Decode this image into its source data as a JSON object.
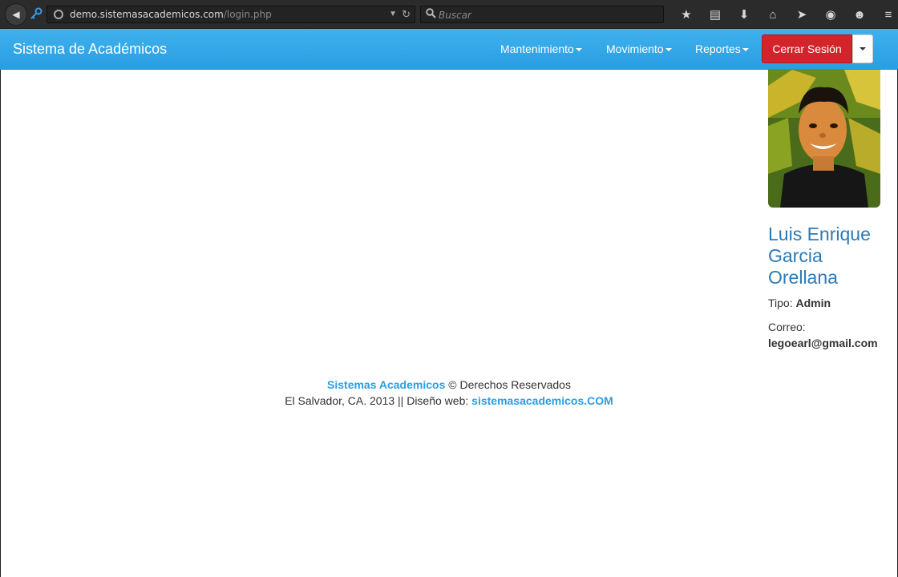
{
  "browser": {
    "url_domain": "demo.sistemasacademicos.com",
    "url_path": "/login.php",
    "search_placeholder": "Buscar",
    "toolbar_icons": [
      "star-icon",
      "reading-list-icon",
      "download-icon",
      "home-icon",
      "send-icon",
      "pocket-icon",
      "chat-icon",
      "menu-icon"
    ]
  },
  "navbar": {
    "brand": "Sistema de Académicos",
    "menu": [
      {
        "label": "Mantenimiento"
      },
      {
        "label": "Movimiento"
      },
      {
        "label": "Reportes"
      }
    ],
    "logout_label": "Cerrar Sesión",
    "color": "#2a9ee0",
    "logout_color": "#d2242b"
  },
  "profile": {
    "name_line1": "Luis Enrique",
    "name_line2": "Garcia",
    "name_line3": "Orellana",
    "tipo_label": "Tipo:",
    "tipo_value": "Admin",
    "correo_label": "Correo:",
    "correo_value": "legoearl@gmail.com"
  },
  "footer": {
    "brand_link": "Sistemas Academicos",
    "rights": "© Derechos Reservados",
    "location": "El Salvador, CA. 2013 || Diseño web:",
    "site_link": "sistemasacademicos.COM"
  }
}
